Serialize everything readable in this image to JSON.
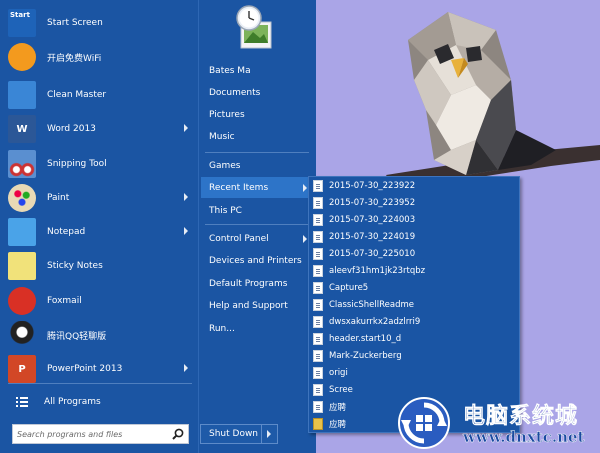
{
  "left_menu": {
    "items": [
      {
        "label": "Start Screen",
        "icon": "start-screen-icon",
        "icon_text": "Start",
        "color": "#1e63b8",
        "submenu": false
      },
      {
        "label": "开启免费WiFi",
        "icon": "wifi-icon",
        "icon_text": "",
        "color": "#f39a1e",
        "submenu": false
      },
      {
        "label": "Clean Master",
        "icon": "broom-icon",
        "icon_text": "",
        "color": "#3a86d6",
        "submenu": false
      },
      {
        "label": "Word 2013",
        "icon": "word-icon",
        "icon_text": "W",
        "color": "#2b5797",
        "submenu": true
      },
      {
        "label": "Snipping Tool",
        "icon": "scissors-icon",
        "icon_text": "",
        "color": "#5a8fd0",
        "submenu": false
      },
      {
        "label": "Paint",
        "icon": "palette-icon",
        "icon_text": "",
        "color": "#e5e5e5",
        "submenu": true
      },
      {
        "label": "Notepad",
        "icon": "notepad-icon",
        "icon_text": "",
        "color": "#4aa3e8",
        "submenu": true
      },
      {
        "label": "Sticky Notes",
        "icon": "sticky-notes-icon",
        "icon_text": "",
        "color": "#f1e27a",
        "submenu": false
      },
      {
        "label": "Foxmail",
        "icon": "foxmail-icon",
        "icon_text": "",
        "color": "#d93025",
        "submenu": false
      },
      {
        "label": "腾讯QQ轻聊版",
        "icon": "qq-penguin-icon",
        "icon_text": "",
        "color": "#1b55a3",
        "submenu": false
      },
      {
        "label": "PowerPoint 2013",
        "icon": "powerpoint-icon",
        "icon_text": "P",
        "color": "#d24726",
        "submenu": true
      }
    ],
    "all_programs": "All Programs",
    "search_placeholder": "Search programs and files"
  },
  "right_menu": {
    "items": [
      {
        "label": "Bates Ma",
        "submenu": false,
        "highlighted": false
      },
      {
        "label": "Documents",
        "submenu": false,
        "highlighted": false
      },
      {
        "label": "Pictures",
        "submenu": false,
        "highlighted": false
      },
      {
        "label": "Music",
        "submenu": false,
        "highlighted": false
      },
      {
        "label": "Games",
        "submenu": false,
        "highlighted": false
      },
      {
        "label": "Recent Items",
        "submenu": true,
        "highlighted": true
      },
      {
        "label": "This PC",
        "submenu": false,
        "highlighted": false
      },
      {
        "label": "Control Panel",
        "submenu": true,
        "highlighted": false
      },
      {
        "label": "Devices and Printers",
        "submenu": false,
        "highlighted": false
      },
      {
        "label": "Default Programs",
        "submenu": false,
        "highlighted": false
      },
      {
        "label": "Help and Support",
        "submenu": false,
        "highlighted": false
      },
      {
        "label": "Run...",
        "submenu": false,
        "highlighted": false
      }
    ],
    "shutdown_label": "Shut Down"
  },
  "recent_items": [
    {
      "label": "2015-07-30_223922",
      "icon": "document-icon"
    },
    {
      "label": "2015-07-30_223952",
      "icon": "document-icon"
    },
    {
      "label": "2015-07-30_224003",
      "icon": "document-icon"
    },
    {
      "label": "2015-07-30_224019",
      "icon": "document-icon"
    },
    {
      "label": "2015-07-30_225010",
      "icon": "document-icon"
    },
    {
      "label": "aleevf31hm1jk23rtqbz",
      "icon": "document-icon"
    },
    {
      "label": "Capture5",
      "icon": "document-icon"
    },
    {
      "label": "ClassicShellReadme",
      "icon": "document-icon"
    },
    {
      "label": "dwsxakurrkx2adzlrri9",
      "icon": "document-icon"
    },
    {
      "label": "header.start10_d",
      "icon": "document-icon"
    },
    {
      "label": "Mark-Zuckerberg",
      "icon": "document-icon"
    },
    {
      "label": "origi",
      "icon": "document-icon"
    },
    {
      "label": "Scree",
      "icon": "document-icon"
    },
    {
      "label": "应聘",
      "icon": "document-icon"
    },
    {
      "label": "应聘",
      "icon": "folder-icon"
    }
  ],
  "watermark": {
    "title": "电脑系统城",
    "url": "www.dnxtc.net"
  }
}
